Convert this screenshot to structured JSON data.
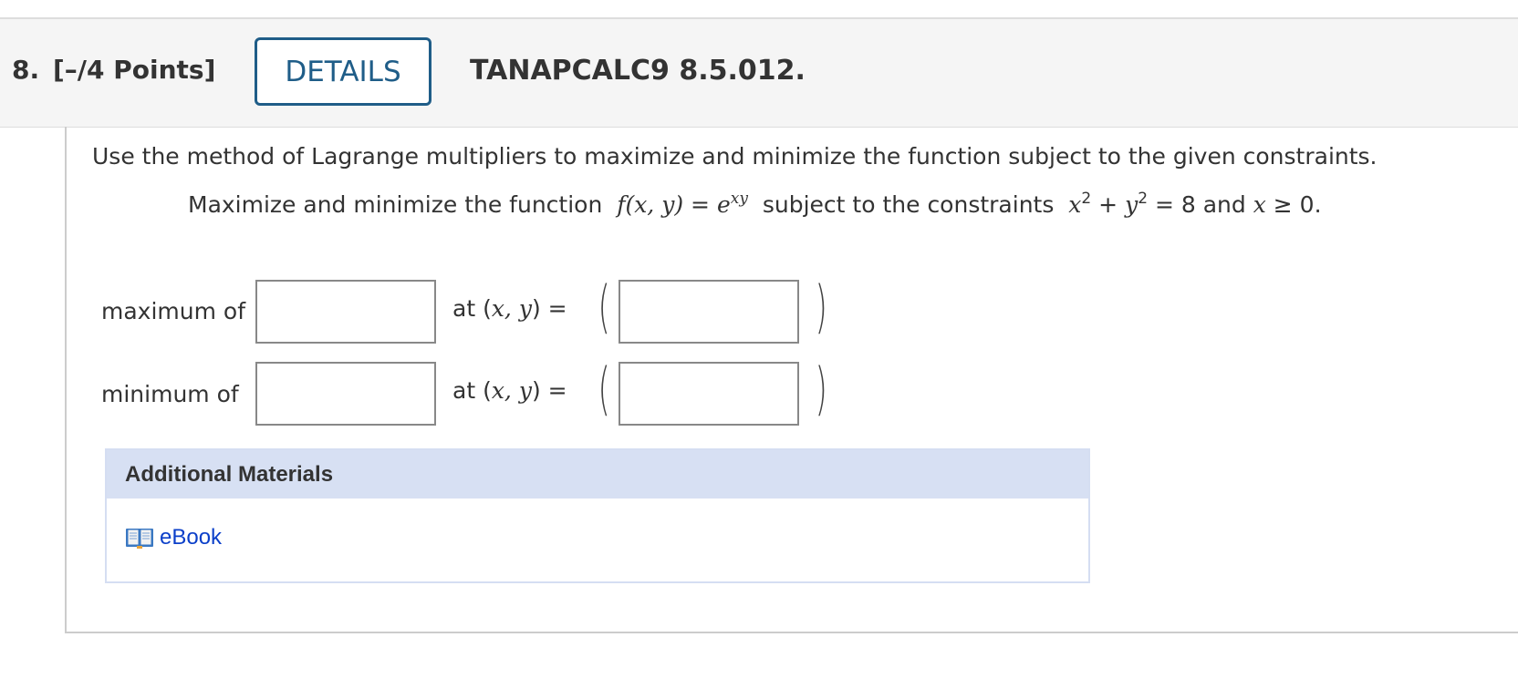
{
  "header": {
    "number": "8.",
    "points": "[–/4 Points]",
    "details_label": "DETAILS",
    "problem_code": "TANAPCALC9 8.5.012."
  },
  "question": {
    "instruction": "Use the method of Lagrange multipliers to maximize and minimize the function subject to the given constraints.",
    "statement_prefix": "Maximize and minimize the function",
    "function_lhs": "f(x, y)",
    "equals": "=",
    "base": "e",
    "exponent": "xy",
    "constraint_text": "subject to the constraints",
    "c_x": "x",
    "c_sq1": "2",
    "c_plus": "+",
    "c_y": "y",
    "c_sq2": "2",
    "c_rhs": "= 8 and",
    "c_x2": "x",
    "c_cond": "≥ 0."
  },
  "answers": {
    "maximum": {
      "label": "maximum of",
      "at_prefix": "at (",
      "at_vars": "x, y",
      "at_suffix": ") =",
      "value": "",
      "point": ""
    },
    "minimum": {
      "label": "minimum of",
      "at_prefix": "at (",
      "at_vars": "x, y",
      "at_suffix": ") =",
      "value": "",
      "point": ""
    },
    "open_paren": "(",
    "close_paren": ")"
  },
  "materials": {
    "title": "Additional Materials",
    "ebook_label": "eBook",
    "ebook_icon": "book-icon"
  },
  "colors": {
    "details_border": "#1f5d88",
    "materials_header": "#d7e0f3",
    "link": "#0b3fc9"
  }
}
